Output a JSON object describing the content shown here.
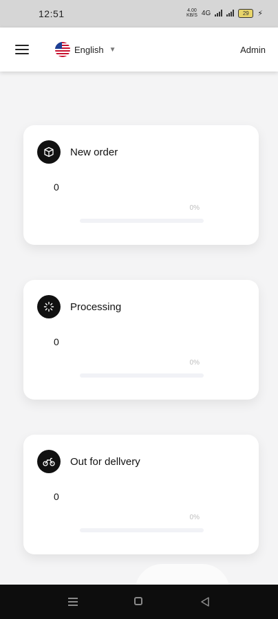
{
  "status_bar": {
    "time": "12:51",
    "net_speed": "4.00",
    "net_unit": "KB/S",
    "sim_label": "4G",
    "battery": "29"
  },
  "app_bar": {
    "language": "English",
    "user": "Admin"
  },
  "cards": [
    {
      "title": "New order",
      "count": "0",
      "percent_label": "0%",
      "progress": 0,
      "icon": "box-icon"
    },
    {
      "title": "Processing",
      "count": "0",
      "percent_label": "0%",
      "progress": 0,
      "icon": "loading-spinner-icon"
    },
    {
      "title": "Out for dellvery",
      "count": "0",
      "percent_label": "0%",
      "progress": 0,
      "icon": "motorbike-icon"
    }
  ],
  "colors": {
    "background": "#f4f4f5",
    "card": "#ffffff",
    "badge": "#111111",
    "track": "#f1f2f6"
  }
}
